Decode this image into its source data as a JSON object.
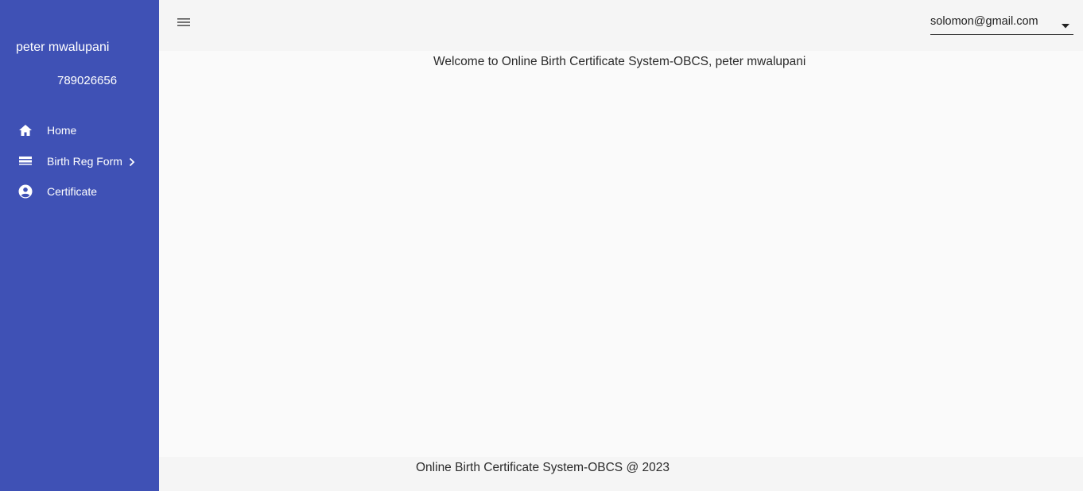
{
  "sidebar": {
    "user_name": "peter mwalupani",
    "user_phone": "789026656",
    "items": [
      {
        "label": "Home",
        "icon": "home-icon"
      },
      {
        "label": "Birth Reg Form",
        "icon": "form-icon",
        "has_submenu": true
      },
      {
        "label": "Certificate",
        "icon": "account-circle-icon"
      }
    ]
  },
  "header": {
    "menu_icon": "menu-icon",
    "account": {
      "value": "solomon@gmail.com"
    }
  },
  "main": {
    "welcome_text": "Welcome to Online Birth Certificate System-OBCS, peter mwalupani"
  },
  "footer": {
    "text": "Online Birth Certificate System-OBCS @ 2023"
  },
  "colors": {
    "sidebar_bg": "#3f51b5",
    "header_bg": "#f5f5f5",
    "main_bg": "#fafafa",
    "text_dark": "#2b2b2b"
  }
}
